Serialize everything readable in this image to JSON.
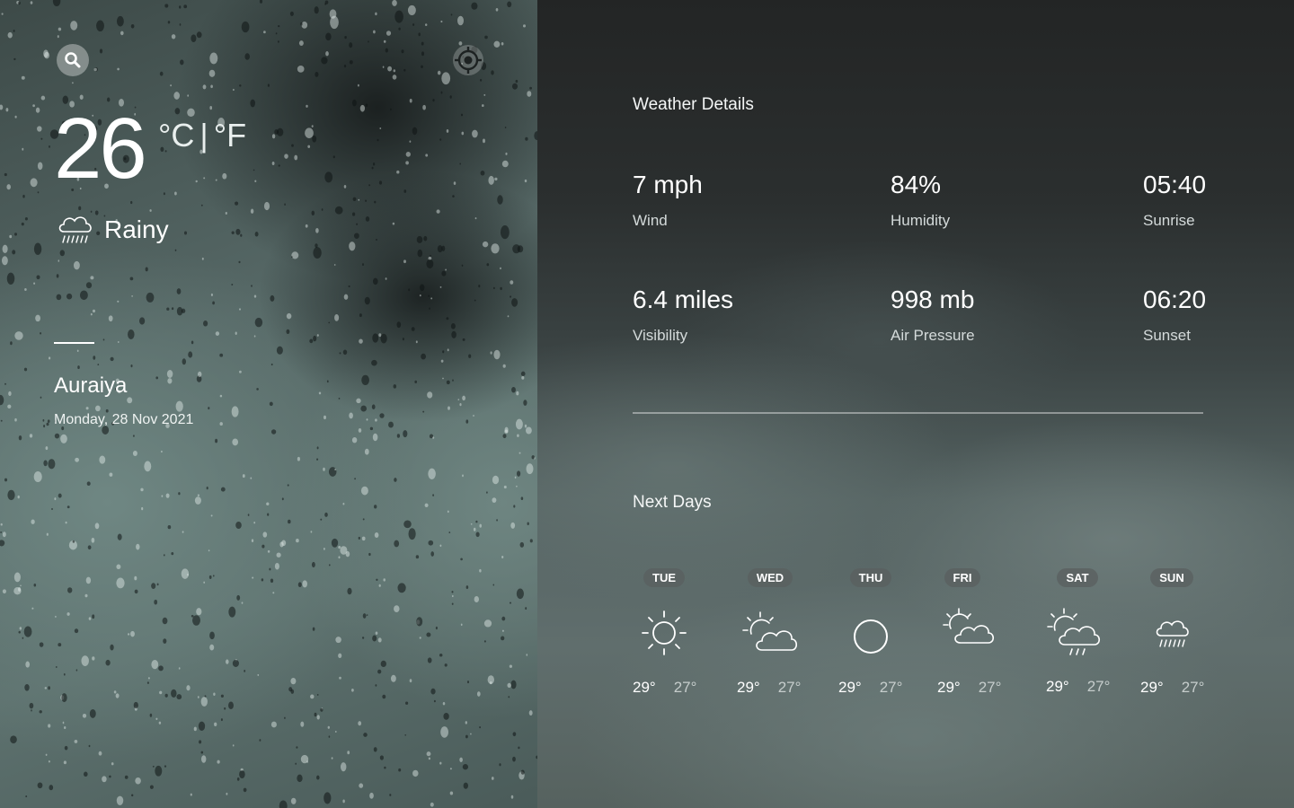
{
  "current": {
    "temperature": "26",
    "unit_c": "°C",
    "unit_sep": "|",
    "unit_f": "°F",
    "condition": "Rainy",
    "condition_icon": "rain-cloud-icon",
    "city": "Auraiya",
    "date": "Monday, 28 Nov 2021"
  },
  "controls": {
    "search_icon": "search-icon",
    "location_icon": "location-target-icon"
  },
  "details": {
    "title": "Weather Details",
    "items": [
      {
        "value": "7 mph",
        "label": "Wind"
      },
      {
        "value": "84%",
        "label": "Humidity"
      },
      {
        "value": "05:40",
        "label": "Sunrise"
      },
      {
        "value": "6.4 miles",
        "label": "Visibility"
      },
      {
        "value": "998 mb",
        "label": "Air Pressure"
      },
      {
        "value": "06:20",
        "label": "Sunset"
      }
    ]
  },
  "forecast": {
    "title": "Next Days",
    "days": [
      {
        "day": "TUE",
        "icon": "sun-icon",
        "high": "29°",
        "low": "27°"
      },
      {
        "day": "WED",
        "icon": "partly-cloudy-icon",
        "high": "29°",
        "low": "27°"
      },
      {
        "day": "THU",
        "icon": "circle-clear-icon",
        "high": "29°",
        "low": "27°"
      },
      {
        "day": "FRI",
        "icon": "partly-cloudy-icon",
        "high": "29°",
        "low": "27°"
      },
      {
        "day": "SAT",
        "icon": "sun-cloud-rain-icon",
        "high": "29°",
        "low": "27°"
      },
      {
        "day": "SUN",
        "icon": "rain-cloud-icon",
        "high": "29°",
        "low": "27°"
      }
    ]
  }
}
